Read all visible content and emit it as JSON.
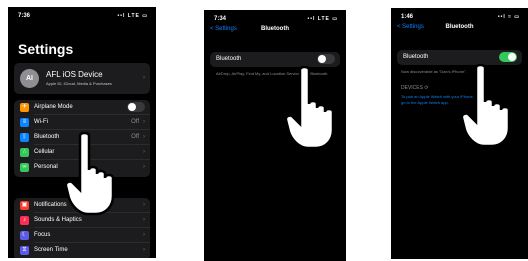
{
  "screen1": {
    "time": "7:36",
    "signal": "••l LTE ▭",
    "title": "Settings",
    "account": {
      "initials": "AI",
      "name": "AFL iOS Device",
      "subtitle": "Apple ID, iCloud, Media & Purchases"
    },
    "group1": [
      {
        "label": "Airplane Mode",
        "value": "",
        "toggle": "off",
        "icon": "airplane-icon",
        "color": "#ff9500",
        "glyph": "✈"
      },
      {
        "label": "Wi-Fi",
        "value": "Off",
        "icon": "wifi-icon",
        "color": "#0a84ff",
        "glyph": "≡"
      },
      {
        "label": "Bluetooth",
        "value": "Off",
        "icon": "bluetooth-icon",
        "color": "#0a84ff",
        "glyph": "ᛒ"
      },
      {
        "label": "Cellular",
        "value": "",
        "icon": "cellular-icon",
        "color": "#34c759",
        "glyph": "∴"
      },
      {
        "label": "Personal",
        "value": "",
        "icon": "hotspot-icon",
        "color": "#34c759",
        "glyph": "∞"
      }
    ],
    "group2": [
      {
        "label": "Notifications",
        "icon": "notifications-icon",
        "color": "#ff3b30",
        "glyph": "▣"
      },
      {
        "label": "Sounds & Haptics",
        "icon": "sound-icon",
        "color": "#ff2d55",
        "glyph": "♪"
      },
      {
        "label": "Focus",
        "icon": "focus-icon",
        "color": "#5e5ce6",
        "glyph": "☾"
      },
      {
        "label": "Screen Time",
        "icon": "screen-time-icon",
        "color": "#5e5ce6",
        "glyph": "⧖"
      }
    ]
  },
  "screen2": {
    "time": "7:34",
    "signal": "••l LTE ▭",
    "back": "< Settings",
    "title": "Bluetooth",
    "row_label": "Bluetooth",
    "toggle": "off",
    "footnote": "AirDrop, AirPlay, Find My, and Location Services use Bluetooth."
  },
  "screen3": {
    "time": "1:46",
    "signal": "••l ≈ ▭",
    "back": "< Settings",
    "title": "Bluetooth",
    "row_label": "Bluetooth",
    "toggle": "on",
    "discoverable": "Now discoverable as “Dan’s iPhone”.",
    "devices_header": "DEVICES",
    "devices_note": "To pair an Apple Watch with your iPhone, go to the Apple Watch app."
  }
}
